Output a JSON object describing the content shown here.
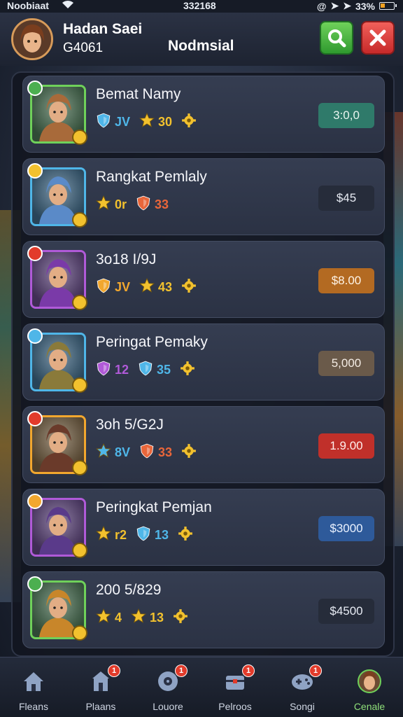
{
  "status": {
    "carrier": "Noobiaat",
    "time": "332168",
    "battery": "33%"
  },
  "header": {
    "player_name": "Hadan Saei",
    "player_id": "G4061",
    "title": "Nodmsial"
  },
  "colors": {
    "search": "#3fae3f",
    "close": "#d83a3a"
  },
  "cards": [
    {
      "name": "Bemat Namy",
      "frame": "#6fd15a",
      "badge": "#4caf50",
      "skin": "#a86a3a",
      "stats": [
        {
          "icon": "shield-icon",
          "color": "#4fb6e8",
          "value": "JV"
        },
        {
          "icon": "star-icon",
          "color": "#f2c12e",
          "value": "30"
        },
        {
          "icon": "gear-icon",
          "color": "#f2c12e",
          "value": ""
        }
      ],
      "price": "3:0,0",
      "price_bg": "#2f7a6a",
      "price_fg": "#e8f4ef"
    },
    {
      "name": "Rangkat Pemlaly",
      "frame": "#4fb6e8",
      "badge": "#f2c12e",
      "skin": "#5a8ac8",
      "stats": [
        {
          "icon": "star-icon",
          "color": "#f2c12e",
          "value": "0r"
        },
        {
          "icon": "shield-icon",
          "color": "#e8663a",
          "value": "33"
        }
      ],
      "price": "$45",
      "price_bg": "#262c3a",
      "price_fg": "#e8ecf4"
    },
    {
      "name": "3o18 I/9J",
      "frame": "#b05ad8",
      "badge": "#e23b2b",
      "skin": "#7a3aa8",
      "stats": [
        {
          "icon": "shield-icon",
          "color": "#f2a72e",
          "value": "JV"
        },
        {
          "icon": "star-icon",
          "color": "#f2c12e",
          "value": "43"
        },
        {
          "icon": "gear-icon",
          "color": "#f2c12e",
          "value": ""
        }
      ],
      "price": "$8.00",
      "price_bg": "#b36a22",
      "price_fg": "#fff5e8"
    },
    {
      "name": "Peringat Pemaky",
      "frame": "#4fb6e8",
      "badge": "#4fb6e8",
      "skin": "#8a7a3a",
      "stats": [
        {
          "icon": "shield-icon",
          "color": "#b05ad8",
          "value": "12"
        },
        {
          "icon": "shield-icon",
          "color": "#4fb6e8",
          "value": "35"
        },
        {
          "icon": "gear-icon",
          "color": "#f2c12e",
          "value": ""
        }
      ],
      "price": "5,000",
      "price_bg": "#6a5a4a",
      "price_fg": "#f4ece4"
    },
    {
      "name": "3oh 5/G2J",
      "frame": "#f2a72e",
      "badge": "#e23b2b",
      "skin": "#6a3a2a",
      "stats": [
        {
          "icon": "star-icon",
          "color": "#4fb6e8",
          "value": "8V"
        },
        {
          "icon": "shield-icon",
          "color": "#e8663a",
          "value": "33"
        },
        {
          "icon": "gear-icon",
          "color": "#f2c12e",
          "value": ""
        }
      ],
      "price": "1.9.00",
      "price_bg": "#c0302a",
      "price_fg": "#fff0ee"
    },
    {
      "name": "Peringkat Pemjan",
      "frame": "#b05ad8",
      "badge": "#f2a72e",
      "skin": "#5a3a8a",
      "stats": [
        {
          "icon": "star-icon",
          "color": "#f2c12e",
          "value": "r2"
        },
        {
          "icon": "shield-icon",
          "color": "#4fb6e8",
          "value": "13"
        },
        {
          "icon": "gear-icon",
          "color": "#f2c12e",
          "value": ""
        }
      ],
      "price": "$3000",
      "price_bg": "#2e5a9a",
      "price_fg": "#eaf2ff"
    },
    {
      "name": "200 5/829",
      "frame": "#6fd15a",
      "badge": "#4caf50",
      "skin": "#c8862a",
      "stats": [
        {
          "icon": "star-icon",
          "color": "#f2c12e",
          "value": "4"
        },
        {
          "icon": "star-icon",
          "color": "#f2c12e",
          "value": "13"
        },
        {
          "icon": "gear-icon",
          "color": "#f2c12e",
          "value": ""
        }
      ],
      "price": "$4500",
      "price_bg": "#262c3a",
      "price_fg": "#e8ecf4"
    }
  ],
  "nav": [
    {
      "label": "Fleans",
      "icon": "home-icon",
      "badge": ""
    },
    {
      "label": "Plaans",
      "icon": "shop-icon",
      "badge": "1"
    },
    {
      "label": "Louore",
      "icon": "disc-icon",
      "badge": "1"
    },
    {
      "label": "Pelroos",
      "icon": "chest-icon",
      "badge": "1"
    },
    {
      "label": "Songi",
      "icon": "controller-icon",
      "badge": "1"
    },
    {
      "label": "Cenale",
      "icon": "profile-icon",
      "badge": ""
    }
  ]
}
